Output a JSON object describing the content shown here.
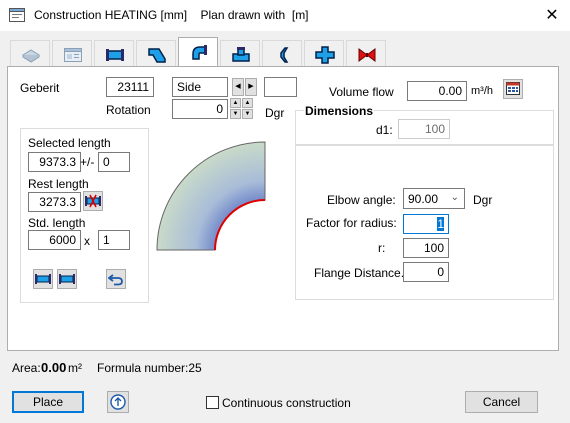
{
  "window": {
    "title": "Construction HEATING [mm]    Plan drawn with  [m]",
    "close_glyph": "✕"
  },
  "tabs": [
    {
      "icon": "insulated-pipe-icon",
      "active": false
    },
    {
      "icon": "table-icon",
      "active": false
    },
    {
      "icon": "straight-pipe-icon",
      "active": false
    },
    {
      "icon": "offset-pipe-icon",
      "active": false
    },
    {
      "icon": "elbow-icon",
      "active": true
    },
    {
      "icon": "tee-icon",
      "active": false
    },
    {
      "icon": "reducer-icon",
      "active": false
    },
    {
      "icon": "cross-icon",
      "active": false
    },
    {
      "icon": "valve-icon",
      "active": false
    }
  ],
  "form": {
    "manufacturer_label": "Geberit",
    "manufacturer_code": "23111",
    "side_value": "Side",
    "rotation_label": "Rotation",
    "rotation_value": "0",
    "rotation_unit": "Dgr",
    "volume_flow_label": "Volume flow",
    "volume_flow_value": "0.00",
    "volume_flow_unit": "m³/h",
    "dimensions_label": "Dimensions",
    "d1_label": "d1:",
    "d1_value": "100",
    "selected_length_label": "Selected length",
    "selected_length_value": "9373.3",
    "tolerance_label": "+/-",
    "tolerance_value": "0",
    "rest_length_label": "Rest length",
    "rest_length_value": "3273.3",
    "std_length_label": "Std. length",
    "std_length_value": "6000",
    "multiply_label": "x",
    "std_count_value": "1",
    "elbow_angle_label": "Elbow angle:",
    "elbow_angle_value": "90.00",
    "elbow_angle_unit": "Dgr",
    "factor_radius_label": "Factor for radius:",
    "factor_radius_value": "1",
    "r_label": "r:",
    "r_value": "100",
    "flange_distance_label": "Flange Distance.:",
    "flange_distance_value": "0"
  },
  "status": {
    "area_label": "Area:",
    "area_value": "0.00",
    "area_unit": "m²",
    "formula_label": "Formula number:25"
  },
  "footer": {
    "place_label": "Place",
    "continuous_label": "Continuous construction",
    "continuous_checked": false,
    "cancel_label": "Cancel"
  },
  "colors": {
    "accent": "#0078d7",
    "elbow_edge": "#e00000"
  }
}
